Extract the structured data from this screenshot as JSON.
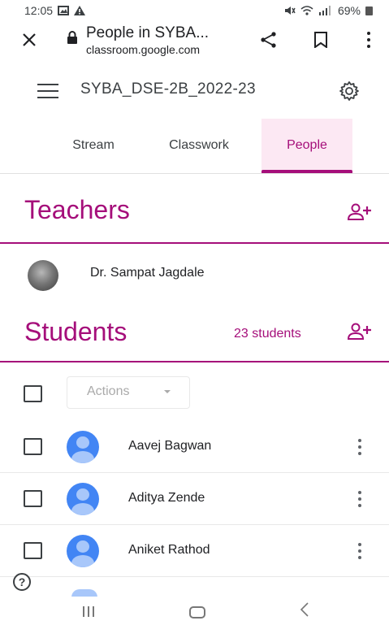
{
  "status_bar": {
    "time": "12:05",
    "battery_text": "69%",
    "left_icons": [
      "gallery-icon",
      "alert-icon"
    ],
    "right_icons": [
      "mute-icon",
      "wifi-icon",
      "signal-icon",
      "battery-icon"
    ]
  },
  "browser": {
    "page_title": "People in SYBA...",
    "url": "classroom.google.com"
  },
  "app": {
    "class_name": "SYBA_DSE-2B_2022-23"
  },
  "tabs": [
    {
      "label": "Stream"
    },
    {
      "label": "Classwork"
    },
    {
      "label": "People",
      "active": true
    }
  ],
  "teachers": {
    "title": "Teachers",
    "items": [
      {
        "name": "Dr. Sampat Jagdale"
      }
    ]
  },
  "students": {
    "title": "Students",
    "count_text": "23 students",
    "actions_label": "Actions",
    "items": [
      {
        "name": "Aavej Bagwan"
      },
      {
        "name": "Aditya Zende"
      },
      {
        "name": "Aniket Rathod"
      }
    ]
  },
  "help_text": "?",
  "colors": {
    "accent": "#a50e7a",
    "active_tab_bg": "#fce8f3",
    "avatar_blue": "#4285f4",
    "avatar_light": "#a8c7fa"
  }
}
